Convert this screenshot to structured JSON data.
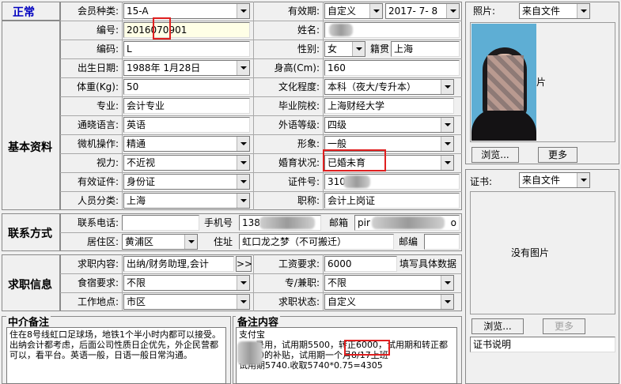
{
  "status": "正常",
  "basic": {
    "title": "基本资料",
    "member_type_label": "会员种类:",
    "member_type_value": "15-A",
    "validity_label": "有效期:",
    "validity_value": "自定义",
    "validity_date": "2017- 7- 8",
    "id_no_label": "编号:",
    "id_no_value": "2016070901",
    "name_label": "姓名:",
    "code_label": "编码:",
    "code_value": "L",
    "gender_label": "性别:",
    "gender_value": "女",
    "native_label": "籍贯",
    "native_value": "上海",
    "birth_label": "出生日期:",
    "birth_value": "1988年 1月28日",
    "height_label": "身高(Cm):",
    "height_value": "160",
    "weight_label": "体重(Kg):",
    "weight_value": "50",
    "education_label": "文化程度:",
    "education_value": "本科（夜大/专升本）",
    "major_label": "专业:",
    "major_value": "会计专业",
    "school_label": "毕业院校:",
    "school_value": "上海财经大学",
    "language_label": "通晓语言:",
    "language_value": "英语",
    "lang_level_label": "外语等级:",
    "lang_level_value": "四级",
    "computer_label": "微机操作:",
    "computer_value": "精通",
    "image_label": "形象:",
    "image_value": "一般",
    "vision_label": "视力:",
    "vision_value": "不近视",
    "marital_label": "婚育状况:",
    "marital_value": "已婚未育",
    "cert_label": "有效证件:",
    "cert_value": "身份证",
    "cert_no_label": "证件号:",
    "cert_no_value": "310",
    "category_label": "人员分类:",
    "category_value": "上海",
    "title_label": "职称:",
    "title_value": "会计上岗证"
  },
  "contact": {
    "title": "联系方式",
    "phone_label": "联系电话:",
    "mobile_label": "手机号",
    "mobile_value": "138",
    "email_label": "邮箱",
    "email_value": "pir",
    "email_tail": "o",
    "district_label": "居住区:",
    "district_value": "黄浦区",
    "address_label": "住址",
    "address_value": "虹口龙之梦（不可搬迁）",
    "postcode_label": "邮编"
  },
  "job": {
    "title": "求职信息",
    "content_label": "求职内容:",
    "content_value": "出纳/财务助理,会计",
    "more_btn": ">>",
    "salary_label": "工资要求:",
    "salary_value": "6000",
    "salary_note": "填写具体数据",
    "accommodation_label": "食宿要求:",
    "accommodation_value": "不限",
    "parttime_label": "专/兼职:",
    "parttime_value": "不限",
    "location_label": "工作地点:",
    "location_value": "市区",
    "jobstatus_label": "求职状态:",
    "jobstatus_value": "自定义"
  },
  "notes": {
    "agency_title": "中介备注",
    "agency_text": "住在8号线虹口足球场，地铁1个半小时内都可以接受。出纳会计都考虑，后面公司性质日企优先，外企民营都可以，看平台。英语一般，日语一般日常沟通。",
    "remark_title": "备注内容",
    "remark_text": "支付宝\n      录用，试用期5500，转正6000，试用期和转正都有240的补贴，试用期一个月8/17上班\n试用期5740.收取5740*0.75=4305"
  },
  "photo": {
    "label": "照片:",
    "source": "来自文件",
    "partial_text": "片",
    "browse_btn": "浏览...",
    "more_btn": "更多"
  },
  "certificate": {
    "label": "证书:",
    "source": "来自文件",
    "empty_text": "没有图片",
    "browse_btn": "浏览...",
    "more_btn": "更多",
    "desc_label": "证书说明"
  },
  "colors": {
    "status_blue": "#0000c0",
    "highlight_red": "#e02020",
    "field_yellow": "#ffffe6"
  }
}
